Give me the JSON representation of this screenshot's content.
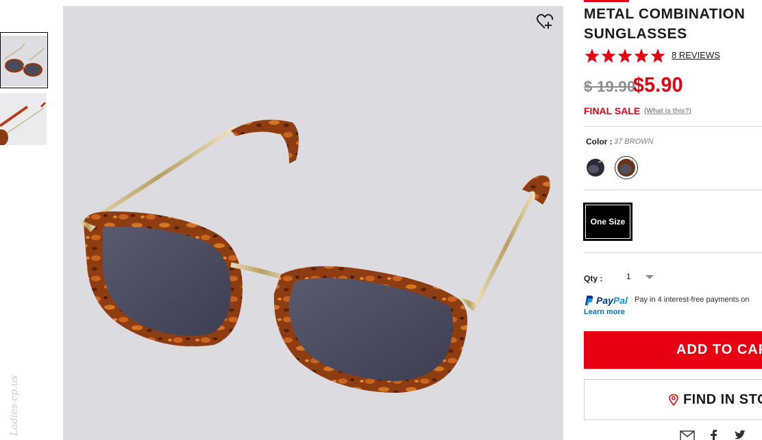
{
  "product": {
    "title_line1": "METAL COMBINATION",
    "title_line2": "SUNGLASSES",
    "rating": 5,
    "reviews_label": "8 REVIEWS",
    "old_price": "$ 19.90",
    "new_price": "$5.90",
    "final_sale": "FINAL SALE",
    "what_is_this": "(What is this?)",
    "color_label": "Color :",
    "color_value": "37 BROWN",
    "swatches": [
      {
        "name": "black",
        "color": "#2a2a30"
      },
      {
        "name": "brown",
        "color": "#5a3a2a",
        "selected": true
      }
    ],
    "size_label": "One Size",
    "qty_label": "Qty :",
    "qty_value": "1",
    "paypal_pay": "Pay",
    "paypal_pal": "Pal",
    "paypal_message": "Pay in 4 interest-free payments on",
    "learn_more": "Learn more",
    "add_to_cart": "ADD TO CAR",
    "find_in_store": "FIND IN STO"
  },
  "watermark": "Ladies-cp.us",
  "colors": {
    "accent": "#e60012",
    "image_bg": "#dcdbe0",
    "tortoise": "#8a3a12",
    "paypal_dark": "#003087",
    "paypal_light": "#009cde"
  },
  "icons": {
    "wishlist": "heart-plus-icon",
    "star": "star-icon",
    "qty_caret": "chevron-down-icon",
    "paypal": "paypal-logo-icon",
    "location": "map-pin-icon",
    "mail": "mail-icon",
    "facebook": "facebook-icon",
    "twitter": "twitter-icon"
  }
}
